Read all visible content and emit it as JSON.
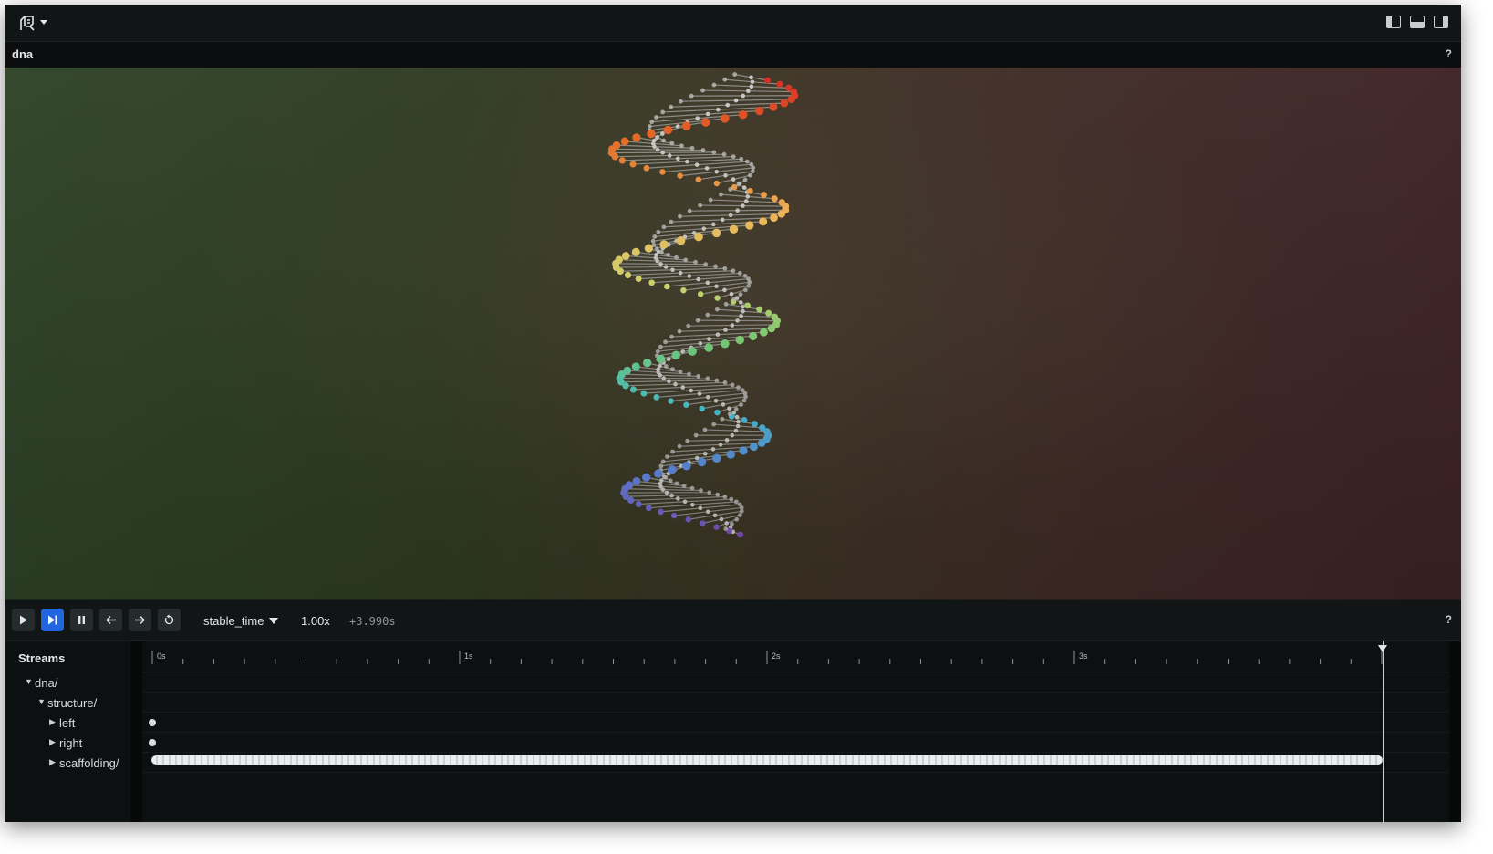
{
  "app": {
    "logo_icon": "rerun-logo-icon",
    "panel_toggles": [
      "left-panel-toggle-icon",
      "bottom-panel-toggle-icon",
      "right-panel-toggle-icon"
    ]
  },
  "view": {
    "title": "dna",
    "help": "?",
    "background_left": "#2d4327",
    "background_right": "#3e2225"
  },
  "controls": {
    "buttons": [
      "play-icon",
      "follow-icon",
      "pause-icon",
      "step-back-icon",
      "step-forward-icon",
      "loop-icon"
    ],
    "active_button": "follow-icon",
    "timeline": "stable_time",
    "speed": "1.00x",
    "offset": "+3.990s",
    "help": "?"
  },
  "streams": {
    "header": "Streams",
    "rows": [
      {
        "label": "dna/",
        "expanded": true
      },
      {
        "label": "structure/",
        "expanded": true
      },
      {
        "label": "left",
        "expanded": false
      },
      {
        "label": "right",
        "expanded": false
      },
      {
        "label": "scaffolding/",
        "expanded": false
      }
    ],
    "ticks": [
      "0s",
      "1s",
      "2s",
      "3s"
    ],
    "accent": "#2166e0"
  }
}
